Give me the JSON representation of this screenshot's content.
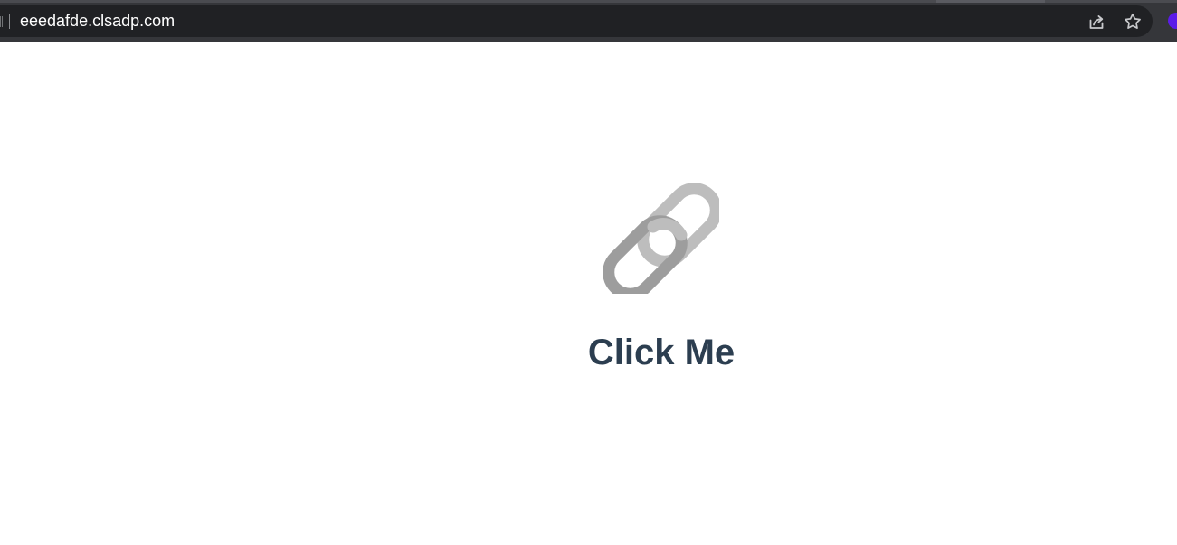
{
  "browser": {
    "url": "eeedafde.clsadp.com",
    "icons": {
      "share": "share-icon",
      "star": "star-icon"
    }
  },
  "main": {
    "link_icon": "link-chain-icon",
    "button_label": "Click Me"
  },
  "colors": {
    "browser_chrome": "#35363a",
    "address_bar": "#202124",
    "url_text": "#ffffff",
    "chain_light": "#bdbdbd",
    "chain_dark": "#9d9d9d",
    "label_text": "#2c3e50",
    "extension_accent": "#5b1be8"
  }
}
